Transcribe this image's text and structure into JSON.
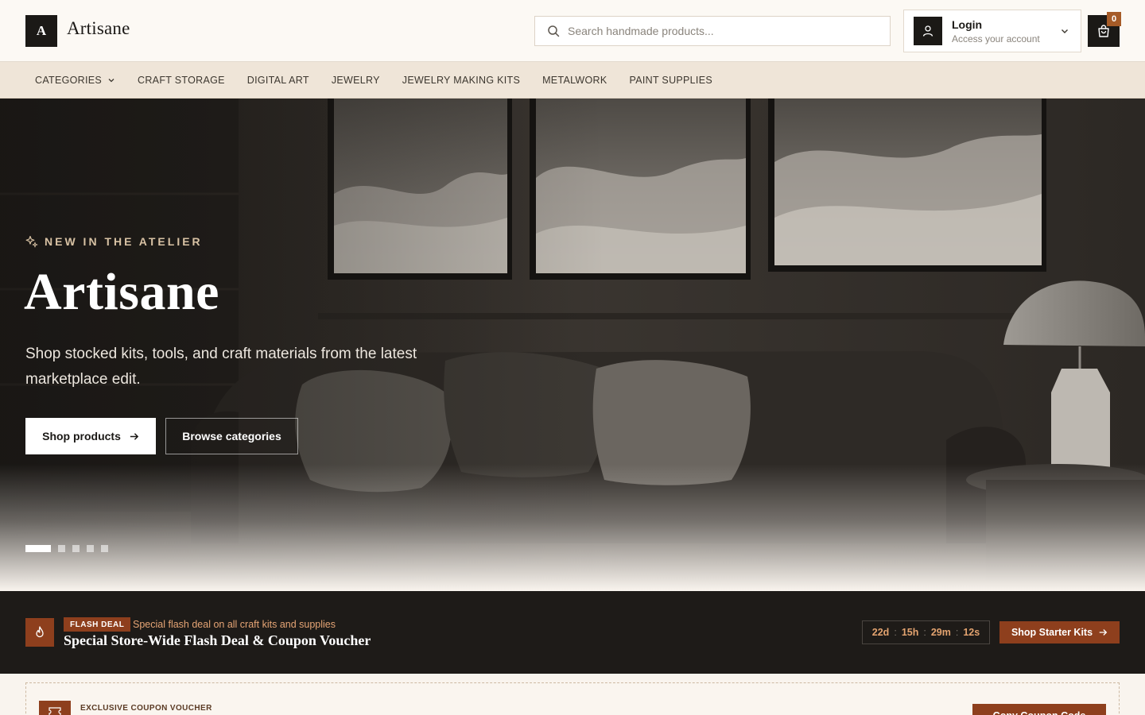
{
  "brand": {
    "logo_letter": "A",
    "name": "Artisane"
  },
  "search": {
    "placeholder": "Search handmade products..."
  },
  "account": {
    "title": "Login",
    "subtitle": "Access your account"
  },
  "cart": {
    "count": "0"
  },
  "nav": {
    "categories_label": "CATEGORIES",
    "items": [
      "CRAFT STORAGE",
      "DIGITAL ART",
      "JEWELRY",
      "JEWELRY MAKING KITS",
      "METALWORK",
      "PAINT SUPPLIES"
    ]
  },
  "hero": {
    "eyebrow": "NEW IN THE ATELIER",
    "title": "Artisane",
    "description": "Shop stocked kits, tools, and craft materials from the latest marketplace edit.",
    "primary_cta": "Shop products",
    "secondary_cta": "Browse categories",
    "slides_total": 5,
    "active_slide": 1
  },
  "flash": {
    "tag": "FLASH DEAL",
    "tagline": "Special flash deal on all craft kits and supplies",
    "headline": "Special Store-Wide Flash Deal & Coupon Voucher",
    "timer": {
      "days": "22d",
      "hours": "15h",
      "minutes": "29m",
      "seconds": "12s"
    },
    "cta": "Shop Starter Kits"
  },
  "coupon": {
    "label": "EXCLUSIVE COUPON VOUCHER",
    "cta": "Copy Coupon Code"
  },
  "colors": {
    "accent": "#8e3f1d",
    "dark": "#1b1916",
    "cream": "#f9f4ee",
    "nav_bg": "#efe5d8",
    "timer_text": "#e3a36f"
  }
}
